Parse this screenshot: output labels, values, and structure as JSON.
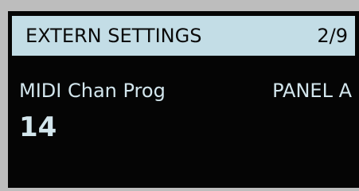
{
  "header": {
    "title": "EXTERN SETTINGS",
    "page": "2/9"
  },
  "parameter": {
    "label": "MIDI Chan Prog",
    "panel": "PANEL A",
    "value": "14"
  },
  "colors": {
    "screen_background": "#050505",
    "header_background": "#c3dde6",
    "text_light": "#d3e6ed",
    "text_dark": "#0a0a0a",
    "bezel": "#bdbdbd"
  }
}
